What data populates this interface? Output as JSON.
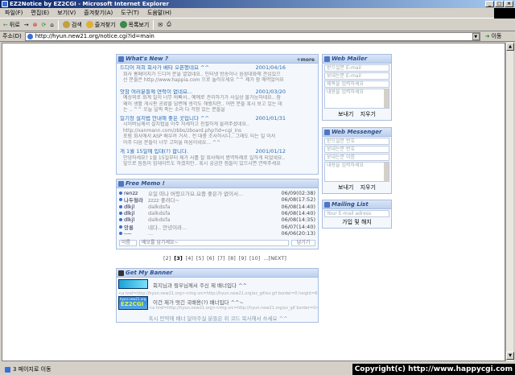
{
  "window": {
    "title": "EZ2Notice by EZ2CGI - Microsoft Internet Explorer",
    "controls": [
      "_",
      "□",
      "×"
    ]
  },
  "menu": [
    "파일(F)",
    "편집(E)",
    "보기(V)",
    "즐겨찾기(A)",
    "도구(T)",
    "도움말(H)"
  ],
  "toolbar": {
    "back": "뒤로",
    "forward": "→",
    "stop": "⊗",
    "refresh": "⟳",
    "home": "⌂",
    "search": "검색",
    "favorites": "즐겨찾기",
    "history": "목록보기",
    "mail": "✉",
    "print": "⎙"
  },
  "address": {
    "label": "주소(D)",
    "url": "http://hyun.new21.org/notice.cgi?id=main",
    "go": "이동"
  },
  "whatsnew": {
    "title": "What's New ?",
    "more": "+more",
    "items": [
      {
        "title": "드디어 저희 회사가 베타 오픈했네요 ^^",
        "date": "2001/04/16",
        "body": [
          "회사 홈페이지가 드디어 문을 열었네요.. 인터넷 방송이나 음성대화에 관심있으",
          "신 분들은 http://www.happia.com 으로 놀러오세요 ^^ 제가 참 애먹었어요"
        ]
      },
      {
        "title": "앗참 여러분들께 연락이 없네요...",
        "date": "2001/03/20",
        "body": [
          "예상외로 회계 일이 너무 바빠서.. 예예로 관리하기가 사실상 불가능하네요.. 참",
          "왜이 생활 게시판 공료를 답변에 생각도 해했지만.. 어떤 분들 혹시 보고 있는 데",
          "는 .. ^^ 오늘 널찍 죽는 소리 다 걱정 있는 분들을"
        ]
      },
      {
        "title": "일기장 설치법 안내해 좋은 곳입니다 ^^",
        "date": "2001/01/31",
        "body": [
          "시이버님께서 설치법을 아주 자세하고 친절하게 올려주셨네요..",
          "http://xanmann.com/zbbs/zboard.php?id=cgi_ins",
          "포럼 회사에서 ASP 배우려 거서.. 전 대충 조사하시니.. 그래도 되는 일 이서",
          "아주 다음 분들이 너무 고마울 마음이네요... ^^"
        ]
      },
      {
        "title": "게 1월 15일에 입대(?) 합니다.",
        "date": "2001/01/12",
        "body": [
          "안녕하세요? 1월 15일부터 제가 사흘 잘 회사에서 병역특례로 일하게 되었네요..",
          "앞으로 틈틈이 업데이트도 하겠지만.. 혹시 궁금한 점들이 있으시면 연락주세요"
        ]
      }
    ]
  },
  "mailer": {
    "title": "Web Mailer",
    "fields": [
      "받으실분 E-mail",
      "보내는분 E-mail",
      "제목을 입력하세요"
    ],
    "message": "내용을 입력하세요",
    "send": "보내기",
    "clear": "지우기"
  },
  "messenger": {
    "title": "Web Messenger",
    "fields": [
      "받으실분 번호",
      "보내는분 번호",
      "보내는분 이름"
    ],
    "message": "내용을 입력하세요",
    "send": "보내기",
    "clear": "지우기"
  },
  "mailing": {
    "title": "Mailing List",
    "field": "Your E-mail adress",
    "join": "가입 및 해지"
  },
  "memo": {
    "title": "Free Memo !",
    "rows": [
      {
        "name": "renzz",
        "text": "오일 떠나 버렸으가요.요즘 좋은가 없어서...",
        "date": "06/09(02:38)"
      },
      {
        "name": "나두혈라",
        "text": "zzzz 좋려다~",
        "date": "06/08(17:52)"
      },
      {
        "name": "dlkjl",
        "text": "dalkdsfa",
        "date": "06/08(14:40)"
      },
      {
        "name": "dlkjl",
        "text": "dalkdsfa",
        "date": "06/08(14:40)"
      },
      {
        "name": "dlkjl",
        "text": "dalkdsfa",
        "date": "06/08(14:35)"
      },
      {
        "name": "앙룡",
        "text": "네다.. 안녕이라...",
        "date": "06/07(14:40)"
      },
      {
        "name": "----",
        "text": "...",
        "date": "06/06(20:13)"
      }
    ],
    "name_ph": "이름",
    "message_ph": "메모를 남기세요~",
    "submit": "남기기"
  },
  "pager": {
    "pages": [
      "[2]",
      "[3]",
      "[4]",
      "[5]",
      "[6]",
      "[7]",
      "[8]",
      "[9]",
      "[10]"
    ],
    "next": "...[NEXT]"
  },
  "banner": {
    "title": "Get My Banner",
    "line1": "회지님과 뭥우님께서 주신 제 배너입다 ^^",
    "code1": "<a href=http://hyun.new21.org><img src=http://hyun.new21.org/ez_gif/ez.gif border=0 height=60>",
    "line2": "이건 제가 멋긴 국배용(?) 배너입다 ^^~",
    "code2": "<a href=http://hyun.new21.org><img src=http://hyun.new21.org/ez_gif border=0></a>",
    "line3": "혹시 만약에 배너 달아주실 분들은 위 코드 복사해서 쓰세요 ^^",
    "logo": "EZ2CGI",
    "logo_sub": "hyun.new21.org"
  },
  "status": {
    "text": "3 페이지로 이동"
  },
  "copyright": "Copyright(c) http://www.happycgi.com"
}
